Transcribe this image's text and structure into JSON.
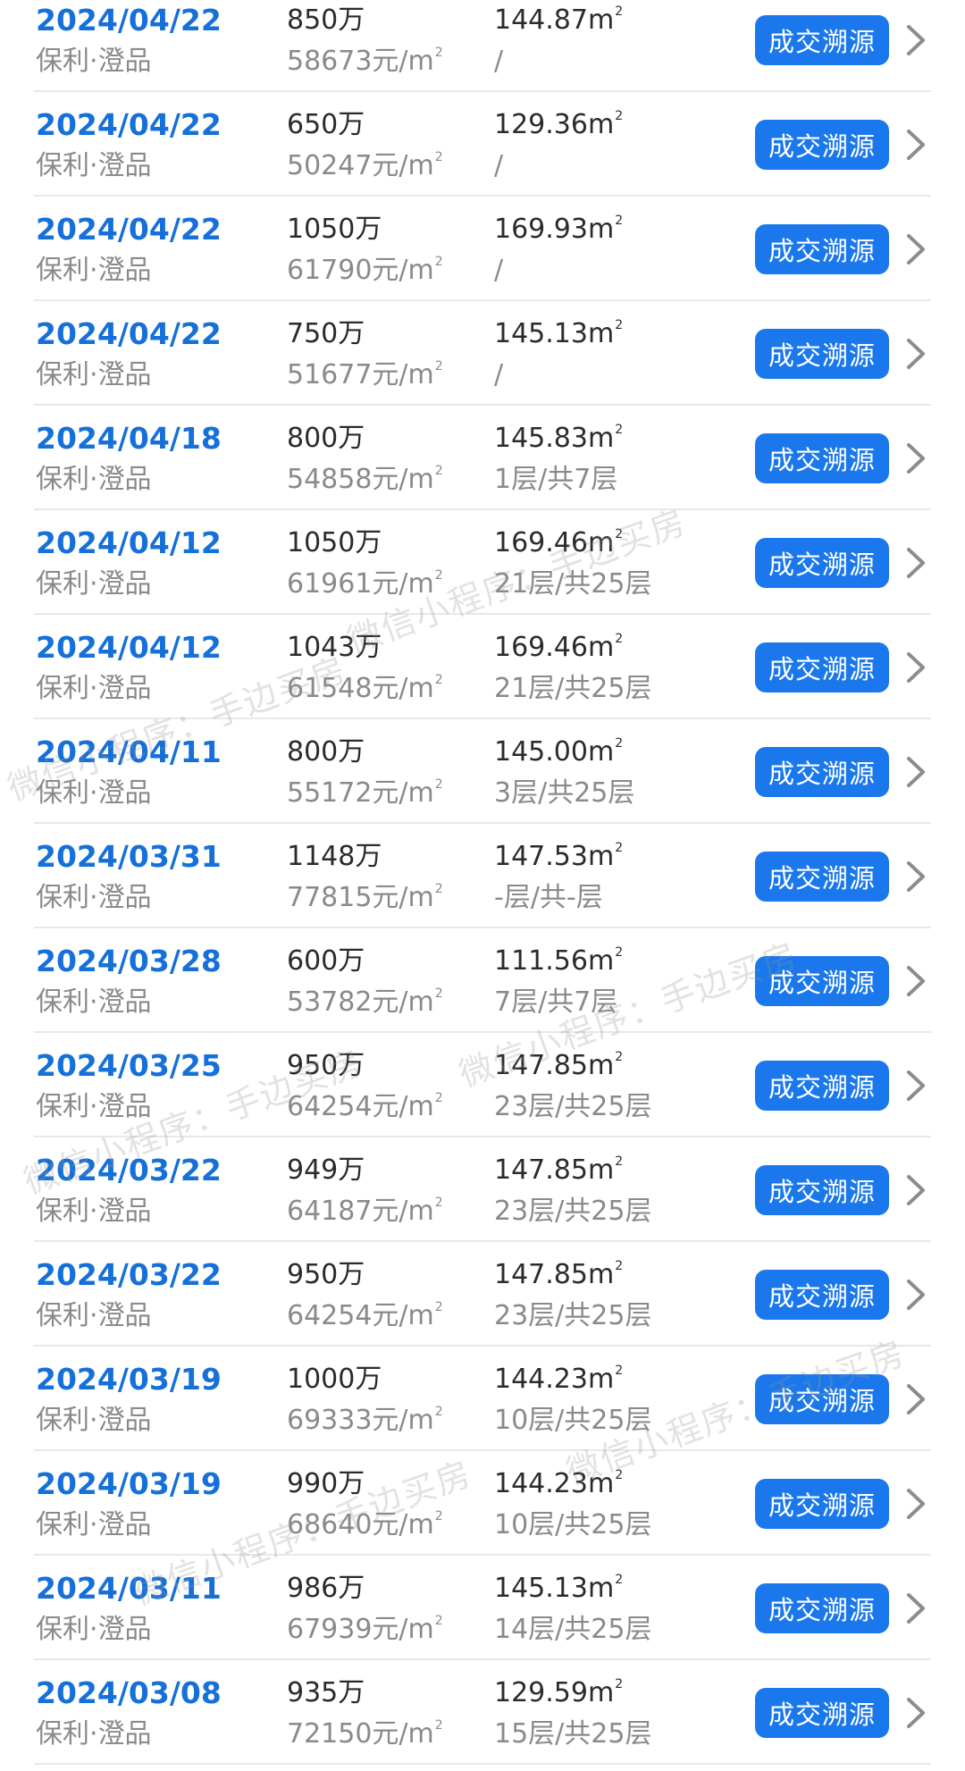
{
  "trace_label": "成交溯源",
  "area_unit": "m",
  "area_unit_sup": "2",
  "unit_price_sup": "2",
  "watermark_text": "微信小程序：手边买房",
  "colors": {
    "date": "#1670d9",
    "button": "#1a78ec",
    "secondary_text": "#8a8a8a",
    "divider": "#e6e8ec"
  },
  "icons": {
    "row_action": "chevron-right-icon"
  },
  "transactions": [
    {
      "date": "2024/04/22",
      "community": "保利·澄品",
      "price": "850万",
      "unit_price": "58673元/m",
      "area": "144.87",
      "floor": "/"
    },
    {
      "date": "2024/04/22",
      "community": "保利·澄品",
      "price": "650万",
      "unit_price": "50247元/m",
      "area": "129.36",
      "floor": "/"
    },
    {
      "date": "2024/04/22",
      "community": "保利·澄品",
      "price": "1050万",
      "unit_price": "61790元/m",
      "area": "169.93",
      "floor": "/"
    },
    {
      "date": "2024/04/22",
      "community": "保利·澄品",
      "price": "750万",
      "unit_price": "51677元/m",
      "area": "145.13",
      "floor": "/"
    },
    {
      "date": "2024/04/18",
      "community": "保利·澄品",
      "price": "800万",
      "unit_price": "54858元/m",
      "area": "145.83",
      "floor": "1层/共7层"
    },
    {
      "date": "2024/04/12",
      "community": "保利·澄品",
      "price": "1050万",
      "unit_price": "61961元/m",
      "area": "169.46",
      "floor": "21层/共25层"
    },
    {
      "date": "2024/04/12",
      "community": "保利·澄品",
      "price": "1043万",
      "unit_price": "61548元/m",
      "area": "169.46",
      "floor": "21层/共25层"
    },
    {
      "date": "2024/04/11",
      "community": "保利·澄品",
      "price": "800万",
      "unit_price": "55172元/m",
      "area": "145.00",
      "floor": "3层/共25层"
    },
    {
      "date": "2024/03/31",
      "community": "保利·澄品",
      "price": "1148万",
      "unit_price": "77815元/m",
      "area": "147.53",
      "floor": "-层/共-层"
    },
    {
      "date": "2024/03/28",
      "community": "保利·澄品",
      "price": "600万",
      "unit_price": "53782元/m",
      "area": "111.56",
      "floor": "7层/共7层"
    },
    {
      "date": "2024/03/25",
      "community": "保利·澄品",
      "price": "950万",
      "unit_price": "64254元/m",
      "area": "147.85",
      "floor": "23层/共25层"
    },
    {
      "date": "2024/03/22",
      "community": "保利·澄品",
      "price": "949万",
      "unit_price": "64187元/m",
      "area": "147.85",
      "floor": "23层/共25层"
    },
    {
      "date": "2024/03/22",
      "community": "保利·澄品",
      "price": "950万",
      "unit_price": "64254元/m",
      "area": "147.85",
      "floor": "23层/共25层"
    },
    {
      "date": "2024/03/19",
      "community": "保利·澄品",
      "price": "1000万",
      "unit_price": "69333元/m",
      "area": "144.23",
      "floor": "10层/共25层"
    },
    {
      "date": "2024/03/19",
      "community": "保利·澄品",
      "price": "990万",
      "unit_price": "68640元/m",
      "area": "144.23",
      "floor": "10层/共25层"
    },
    {
      "date": "2024/03/11",
      "community": "保利·澄品",
      "price": "986万",
      "unit_price": "67939元/m",
      "area": "145.13",
      "floor": "14层/共25层"
    },
    {
      "date": "2024/03/08",
      "community": "保利·澄品",
      "price": "935万",
      "unit_price": "72150元/m",
      "area": "129.59",
      "floor": "15层/共25层"
    }
  ]
}
